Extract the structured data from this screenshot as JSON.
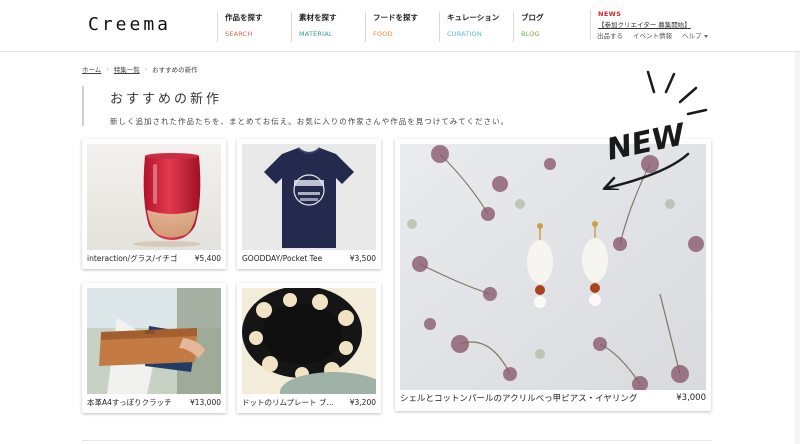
{
  "header": {
    "logo": "Creema",
    "nav": [
      {
        "jp": "作品を探す",
        "en": "SEARCH",
        "color": "#e4685a"
      },
      {
        "jp": "素材を探す",
        "en": "MATERIAL",
        "color": "#2f9e8f"
      },
      {
        "jp": "フードを探す",
        "en": "FOOD",
        "color": "#e58a2a"
      },
      {
        "jp": "キュレーション",
        "en": "CURATION",
        "color": "#5db6d8"
      },
      {
        "jp": "ブログ",
        "en": "BLOG",
        "color": "#78a83a"
      }
    ],
    "news_label": "NEWS",
    "news_text": "【参加クリエイター 募集開始】",
    "util": {
      "publish": "出品する",
      "events": "イベント情報",
      "help": "ヘルプ"
    }
  },
  "breadcrumb": {
    "home": "ホーム",
    "features": "特集一覧",
    "current": "おすすめの新作"
  },
  "page": {
    "title": "おすすめの新作",
    "description": "新しく追加された作品たちを、まとめてお伝え。お気に入りの作家さんや作品を見つけてみてください。"
  },
  "products": [
    {
      "name": "interaction/グラス/イチゴ",
      "price": "¥5,400"
    },
    {
      "name": "GOODDAY/Pocket Tee",
      "price": "¥3,500"
    },
    {
      "name": "本革A4すっぽりクラッチ",
      "price": "¥13,000"
    },
    {
      "name": "ドットのリムプレート ブラック",
      "price": "¥3,200"
    },
    {
      "name": "シェルとコットンパールのアクリルべっ甲ピアス・イヤリング",
      "price": "¥3,000"
    }
  ],
  "badge": {
    "text": "NEW"
  },
  "colors": {
    "news": "#d6202b",
    "border": "#e3e3e3"
  }
}
